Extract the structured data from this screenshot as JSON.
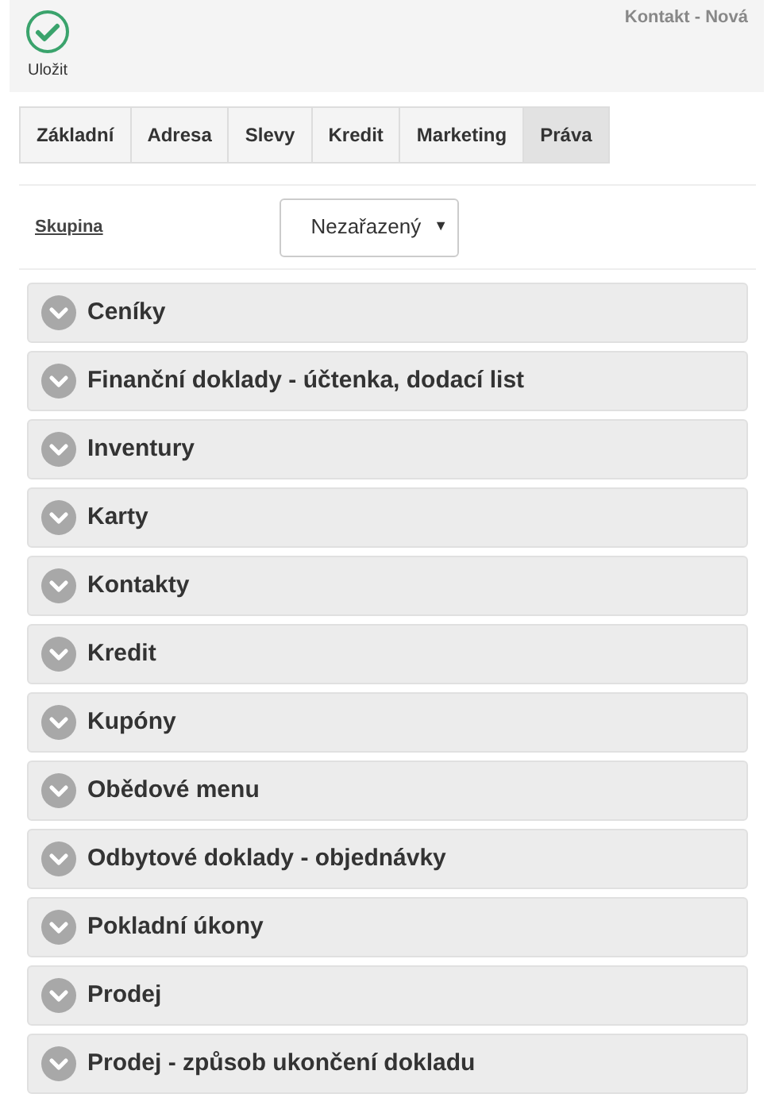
{
  "toolbar": {
    "save_label": "Uložit",
    "title": "Kontakt - Nová"
  },
  "tabs": [
    {
      "label": "Základní",
      "selected": false
    },
    {
      "label": "Adresa",
      "selected": false
    },
    {
      "label": "Slevy",
      "selected": false
    },
    {
      "label": "Kredit",
      "selected": false
    },
    {
      "label": "Marketing",
      "selected": false
    },
    {
      "label": "Práva",
      "selected": true
    }
  ],
  "group": {
    "label": "Skupina",
    "value": "Nezařazený",
    "caret": "▼"
  },
  "sections": [
    {
      "title": "Ceníky",
      "expanded": false
    },
    {
      "title": "Finanční doklady - účtenka, dodací list",
      "expanded": false
    },
    {
      "title": "Inventury",
      "expanded": false
    },
    {
      "title": "Karty",
      "expanded": false
    },
    {
      "title": "Kontakty",
      "expanded": false
    },
    {
      "title": "Kredit",
      "expanded": false
    },
    {
      "title": "Kupóny",
      "expanded": false
    },
    {
      "title": "Obědové menu",
      "expanded": false
    },
    {
      "title": "Odbytové doklady - objednávky",
      "expanded": false
    },
    {
      "title": "Pokladní úkony",
      "expanded": false
    },
    {
      "title": "Prodej",
      "expanded": false
    },
    {
      "title": "Prodej - způsob ukončení dokladu",
      "expanded": false
    }
  ]
}
